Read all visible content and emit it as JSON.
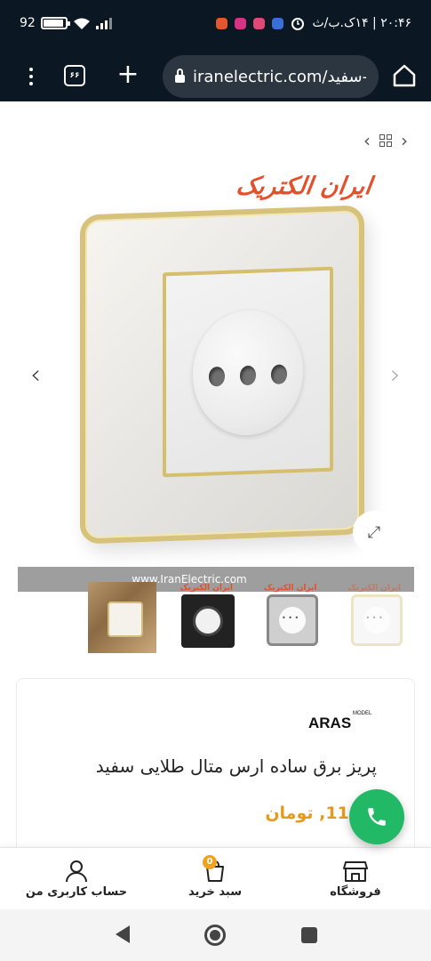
{
  "status_bar": {
    "battery_text": "92",
    "battery_level": 0.92,
    "time_text": "۲۰:۴۶ | ۱۴ک.ب/ث",
    "notification_colors": [
      "#e4572e",
      "#d63384",
      "#e04878",
      "#3b6fd8"
    ]
  },
  "browser": {
    "url": "iranelectric.com/سفید-",
    "tabs_count": "۶۶"
  },
  "gallery": {
    "brand_logo": "ایران الکتریک",
    "watermark": "www.IranElectric.com",
    "thumbs_brand": [
      "ایران الکتریک",
      "ایران الکتریک",
      "ایران الکتریک"
    ]
  },
  "product": {
    "model_label": "ARAS",
    "model_sup": "MODEL",
    "title": "پریز برق ساده ارس متال طلایی سفید",
    "price": "111, تومان"
  },
  "bottom_nav": {
    "shop": "فروشگاه",
    "cart": "سبد خرید",
    "cart_count": "0",
    "account": "حساب کاربری من"
  },
  "colors": {
    "accent": "#e4502b",
    "price": "#e69a1c",
    "call": "#21b866",
    "dark_bar": "#0b1722"
  }
}
